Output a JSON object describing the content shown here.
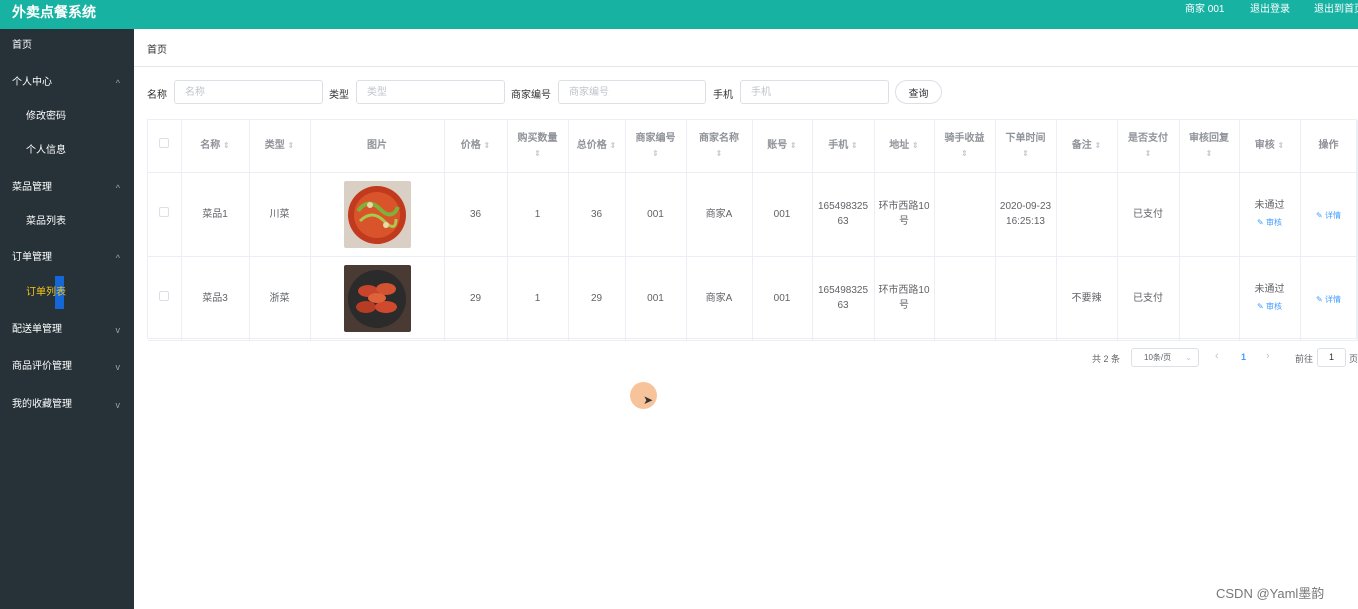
{
  "header": {
    "title": "外卖点餐系统",
    "user": "商家 001",
    "logout": "退出登录",
    "back_home": "退出到首页"
  },
  "sidebar": {
    "items": [
      {
        "label": "首页",
        "chev": ""
      },
      {
        "label": "个人中心",
        "chev": "^"
      },
      {
        "label": "修改密码",
        "chev": ""
      },
      {
        "label": "个人信息",
        "chev": ""
      },
      {
        "label": "菜品管理",
        "chev": "^"
      },
      {
        "label": "菜品列表",
        "chev": ""
      },
      {
        "label": "订单管理",
        "chev": "^"
      },
      {
        "label": "订单列表",
        "chev": ""
      },
      {
        "label": "配送单管理",
        "chev": "v"
      },
      {
        "label": "商品评价管理",
        "chev": "v"
      },
      {
        "label": "我的收藏管理",
        "chev": "v"
      }
    ]
  },
  "breadcrumb": "首页",
  "search": {
    "name_label": "名称",
    "name_placeholder": "名称",
    "type_label": "类型",
    "type_placeholder": "类型",
    "merchant_label": "商家编号",
    "merchant_placeholder": "商家编号",
    "phone_label": "手机",
    "phone_placeholder": "手机",
    "query_button": "查询"
  },
  "table": {
    "sort_icon": "⇕",
    "columns": [
      {
        "label": "",
        "sortable": false
      },
      {
        "label": "名称",
        "sortable": true
      },
      {
        "label": "类型",
        "sortable": true
      },
      {
        "label": "图片",
        "sortable": false
      },
      {
        "label": "价格",
        "sortable": true
      },
      {
        "label": "购买数量",
        "sortable": true
      },
      {
        "label": "总价格",
        "sortable": true
      },
      {
        "label": "商家编号",
        "sortable": true
      },
      {
        "label": "商家名称",
        "sortable": true
      },
      {
        "label": "账号",
        "sortable": true
      },
      {
        "label": "手机",
        "sortable": true
      },
      {
        "label": "地址",
        "sortable": true
      },
      {
        "label": "骑手收益",
        "sortable": true
      },
      {
        "label": "下单时间",
        "sortable": true
      },
      {
        "label": "备注",
        "sortable": true
      },
      {
        "label": "是否支付",
        "sortable": true
      },
      {
        "label": "审核回复",
        "sortable": true
      },
      {
        "label": "审核",
        "sortable": true
      },
      {
        "label": "操作",
        "sortable": false
      }
    ],
    "rows": [
      {
        "name": "菜品1",
        "type": "川菜",
        "image": "dish-sichuan",
        "price": "36",
        "qty": "1",
        "total": "36",
        "merchant_no": "001",
        "merchant_name": "商家A",
        "account": "001",
        "phone": "16549832563",
        "address": "环市西路10号",
        "rider_income": "",
        "order_time": "2020-09-23 16:25:13",
        "remark": "",
        "paid": "已支付",
        "reply": "",
        "audit_status": "未通过",
        "audit_link": "审核",
        "detail_link": "详情"
      },
      {
        "name": "菜品3",
        "type": "浙菜",
        "image": "dish-shrimp",
        "price": "29",
        "qty": "1",
        "total": "29",
        "merchant_no": "001",
        "merchant_name": "商家A",
        "account": "001",
        "phone": "16549832563",
        "address": "环市西路10号",
        "rider_income": "",
        "order_time": "",
        "remark": "不要辣",
        "paid": "已支付",
        "reply": "",
        "audit_status": "未通过",
        "audit_link": "审核",
        "detail_link": "详情"
      }
    ]
  },
  "pagination": {
    "total": "共 2 条",
    "page_size": "10条/页",
    "prev": "‹",
    "current": "1",
    "next": "›",
    "goto": "前往",
    "goto_value": "1",
    "page_suffix": "页"
  },
  "watermark": "CSDN @Yaml墨韵",
  "colors": {
    "header": "#18b2a3",
    "sidebar": "#263238",
    "active_text": "#f5c518",
    "link": "#409eff"
  }
}
